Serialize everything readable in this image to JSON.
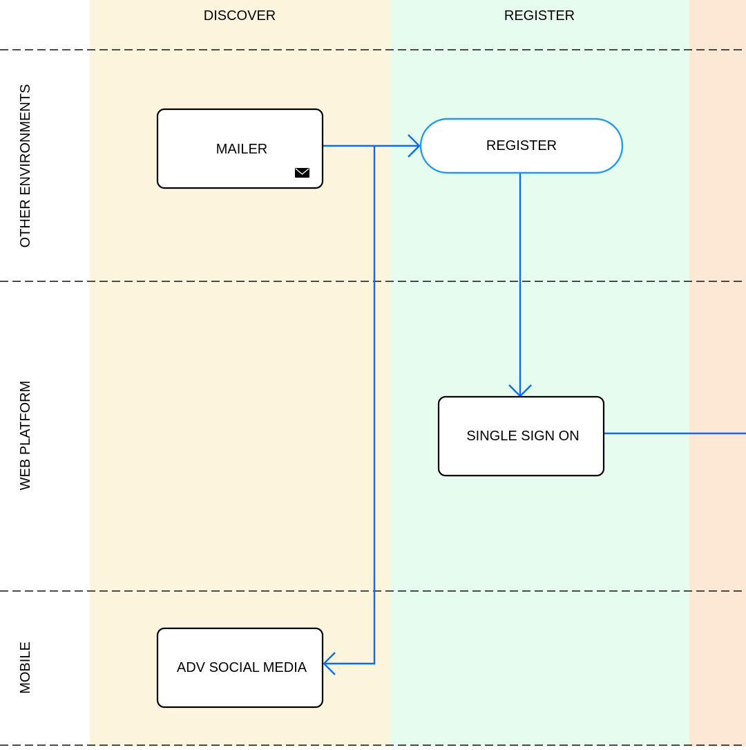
{
  "columns": [
    {
      "label": "DISCOVER",
      "color": "#fcf4dc"
    },
    {
      "label": "REGISTER",
      "color": "#e6fcef"
    },
    {
      "label": "",
      "color": "#fde8d6"
    }
  ],
  "rows": [
    {
      "label": "OTHER ENVIRONMENTS"
    },
    {
      "label": "WEB PLATFORM"
    },
    {
      "label": "MOBILE"
    }
  ],
  "nodes": {
    "mailer": {
      "label": "MAILER",
      "icon": "envelope-icon"
    },
    "register": {
      "label": "REGISTER",
      "shape": "terminator",
      "color": "#1a9bf0"
    },
    "sso": {
      "label": "SINGLE SIGN ON"
    },
    "adv": {
      "label": "ADV SOCIAL MEDIA"
    }
  },
  "edges": [
    {
      "from": "mailer",
      "to": "register"
    },
    {
      "from": "mailer",
      "to": "adv"
    },
    {
      "from": "register",
      "to": "sso"
    },
    {
      "from": "sso",
      "to": "offscreen-right"
    }
  ],
  "edge_color": "#0a6cf5"
}
